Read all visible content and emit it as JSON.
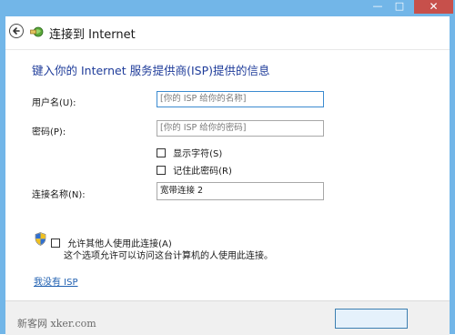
{
  "window": {
    "minimize_glyph": "—",
    "maximize_glyph": "□",
    "close_glyph": "✕"
  },
  "header": {
    "title": "连接到 Internet"
  },
  "form": {
    "heading": "键入你的 Internet 服务提供商(ISP)提供的信息",
    "username": {
      "label": "用户名(U):",
      "placeholder": "[你的 ISP 给你的名称]",
      "value": ""
    },
    "password": {
      "label": "密码(P):",
      "placeholder": "[你的 ISP 给你的密码]",
      "value": ""
    },
    "show_chars": {
      "label": "显示字符(S)",
      "checked": false
    },
    "remember_password": {
      "label": "记住此密码(R)",
      "checked": false
    },
    "connection_name": {
      "label": "连接名称(N):",
      "value": "宽带连接 2"
    },
    "allow_others": {
      "label": "允许其他人使用此连接(A)",
      "description": "这个选项允许可以访问这台计算机的人使用此连接。",
      "checked": false
    },
    "no_isp_link": "我没有 ISP"
  },
  "footer": {
    "watermark": "新客网 xker.com"
  },
  "colors": {
    "titlebar": "#72b6e8",
    "close": "#c7504b",
    "heading": "#1f3c9a",
    "link": "#1f5fb0",
    "input_focus": "#3b8bd0"
  },
  "icons": {
    "back": "back-arrow-icon",
    "app": "network-connection-icon",
    "shield": "uac-shield-icon"
  }
}
